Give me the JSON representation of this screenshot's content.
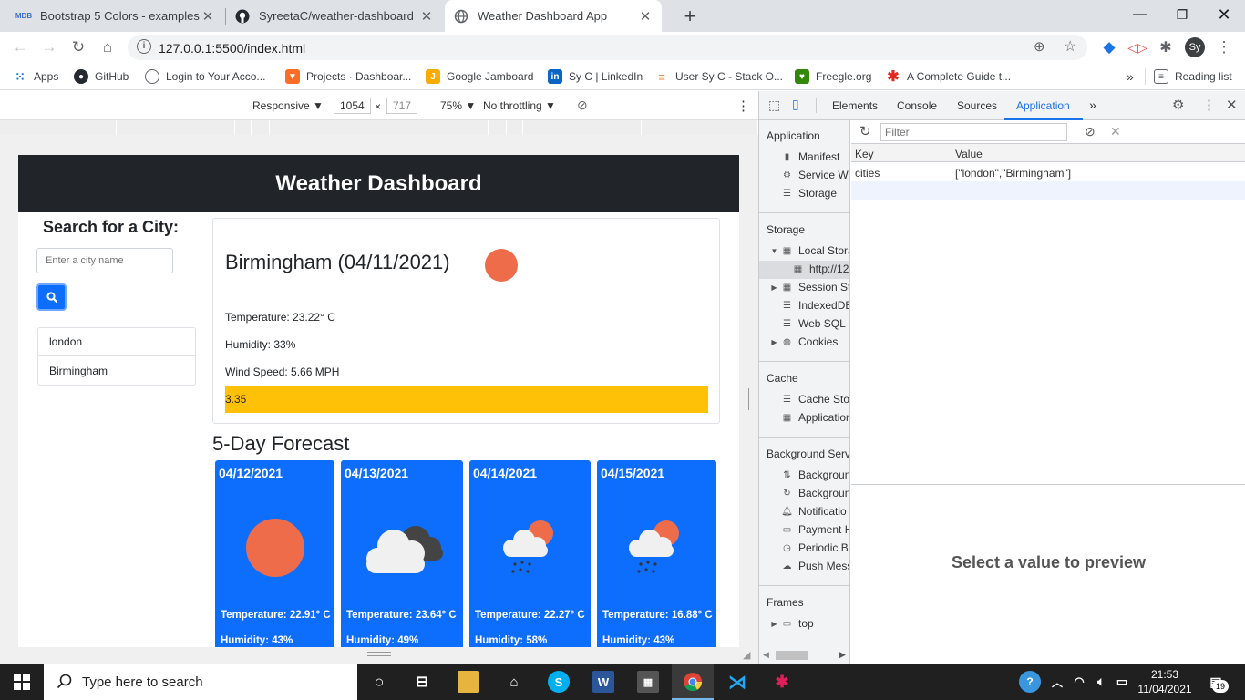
{
  "browser": {
    "tabs": [
      {
        "title": "Bootstrap 5 Colors - examples &",
        "favicon": "MDB",
        "active": false
      },
      {
        "title": "SyreetaC/weather-dashboard",
        "favicon": "github-icon",
        "active": false
      },
      {
        "title": "Weather Dashboard App",
        "favicon": "globe-icon",
        "active": true
      }
    ],
    "url": "127.0.0.1:5500/index.html",
    "profile": "Sy",
    "bookmarks": [
      {
        "label": "Apps",
        "icon": "apps-grid-icon"
      },
      {
        "label": "GitHub",
        "icon": "github-icon"
      },
      {
        "label": "Login to Your Acco...",
        "icon": "globe-icon"
      },
      {
        "label": "Projects · Dashboar...",
        "icon": "gitlab-icon"
      },
      {
        "label": "Google Jamboard",
        "icon": "jamboard-icon"
      },
      {
        "label": "Sy C | LinkedIn",
        "icon": "linkedin-icon"
      },
      {
        "label": "User Sy C - Stack O...",
        "icon": "stackoverflow-icon"
      },
      {
        "label": "Freegle.org",
        "icon": "freegle-icon"
      },
      {
        "label": "A Complete Guide t...",
        "icon": "asterisk-icon"
      }
    ],
    "reading_list": "Reading list",
    "more_bookmarks": "»"
  },
  "device_toolbar": {
    "mode": "Responsive ▼",
    "width": "1054",
    "height": "717",
    "zoom": "75% ▼",
    "throttling": "No throttling ▼"
  },
  "app": {
    "header": "Weather Dashboard",
    "search_title": "Search for a City:",
    "search_placeholder": "Enter a city name",
    "history": [
      "london",
      "Birmingham"
    ],
    "current": {
      "city_title": "Birmingham (04/11/2021)",
      "temperature": "Temperature: 23.22° C",
      "humidity": "Humidity: 33%",
      "wind": "Wind Speed: 5.66 MPH",
      "uv_index": "3.35"
    },
    "forecast_title": "5-Day Forecast",
    "forecast": [
      {
        "date": "04/12/2021",
        "icon": "sun-icon",
        "temp": "Temperature: 22.91° C",
        "humidity": "Humidity: 43%"
      },
      {
        "date": "04/13/2021",
        "icon": "cloudy-icon",
        "temp": "Temperature: 23.64° C",
        "humidity": "Humidity: 49%"
      },
      {
        "date": "04/14/2021",
        "icon": "sun-rain-icon",
        "temp": "Temperature: 22.27° C",
        "humidity": "Humidity: 58%"
      },
      {
        "date": "04/15/2021",
        "icon": "sun-rain-icon",
        "temp": "Temperature: 16.88° C",
        "humidity": "Humidity: 43%"
      }
    ],
    "colors": {
      "header_bg": "#212529",
      "card_bg": "#0d6efd",
      "uv_bar": "#ffc107",
      "sun": "#ef6c4b"
    }
  },
  "devtools": {
    "tabs": [
      "Elements",
      "Console",
      "Sources",
      "Application",
      "»"
    ],
    "active_tab": "Application",
    "sidebar": {
      "application_head": "Application",
      "application_items": [
        "Manifest",
        "Service Wo",
        "Storage"
      ],
      "storage_head": "Storage",
      "storage_items": [
        "Local Stora",
        "http://12",
        "Session Sto",
        "IndexedDB",
        "Web SQL",
        "Cookies"
      ],
      "cache_head": "Cache",
      "cache_items": [
        "Cache Stor",
        "Application"
      ],
      "bg_head": "Background Servi",
      "bg_items": [
        "Backgroun",
        "Backgroun",
        "Notificatio",
        "Payment H",
        "Periodic Ba",
        "Push Mess"
      ],
      "frames_head": "Frames",
      "frames_items": [
        "top"
      ]
    },
    "filter_placeholder": "Filter",
    "table_headers": [
      "Key",
      "Value"
    ],
    "rows": [
      {
        "key": "cities",
        "value": "[\"london\",\"Birmingham\"]"
      }
    ],
    "preview_text": "Select a value to preview"
  },
  "taskbar": {
    "search_placeholder": "Type here to search",
    "time": "21:53",
    "date": "11/04/2021",
    "notifications": "19"
  }
}
